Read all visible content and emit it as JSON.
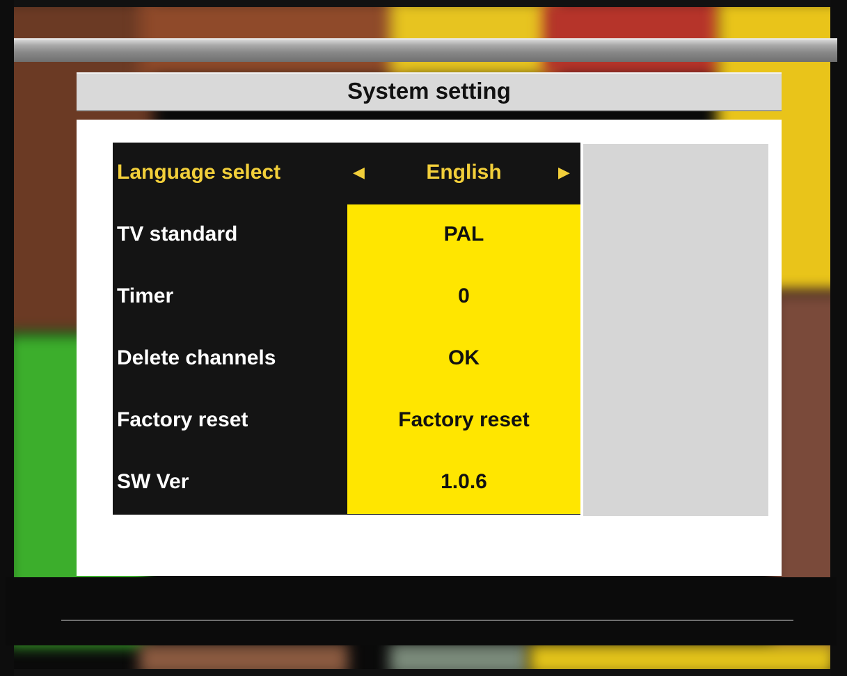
{
  "screen_title": "System setting",
  "menu": {
    "rows": [
      {
        "label": "Language select",
        "value": "English"
      },
      {
        "label": "TV standard",
        "value": "PAL"
      },
      {
        "label": "Timer",
        "value": "0"
      },
      {
        "label": "Delete channels",
        "value": "OK"
      },
      {
        "label": "Factory reset",
        "value": "Factory reset"
      },
      {
        "label": "SW Ver",
        "value": "1.0.6"
      }
    ],
    "selected_index": 0,
    "left_arrow_icon": "left-arrow-icon",
    "right_arrow_icon": "right-arrow-icon"
  },
  "colors": {
    "highlight_text": "#f2cf3a",
    "value_background": "#ffe600",
    "menu_background": "#141414",
    "panel_background": "#ffffff",
    "title_background": "#d9d9d9"
  }
}
